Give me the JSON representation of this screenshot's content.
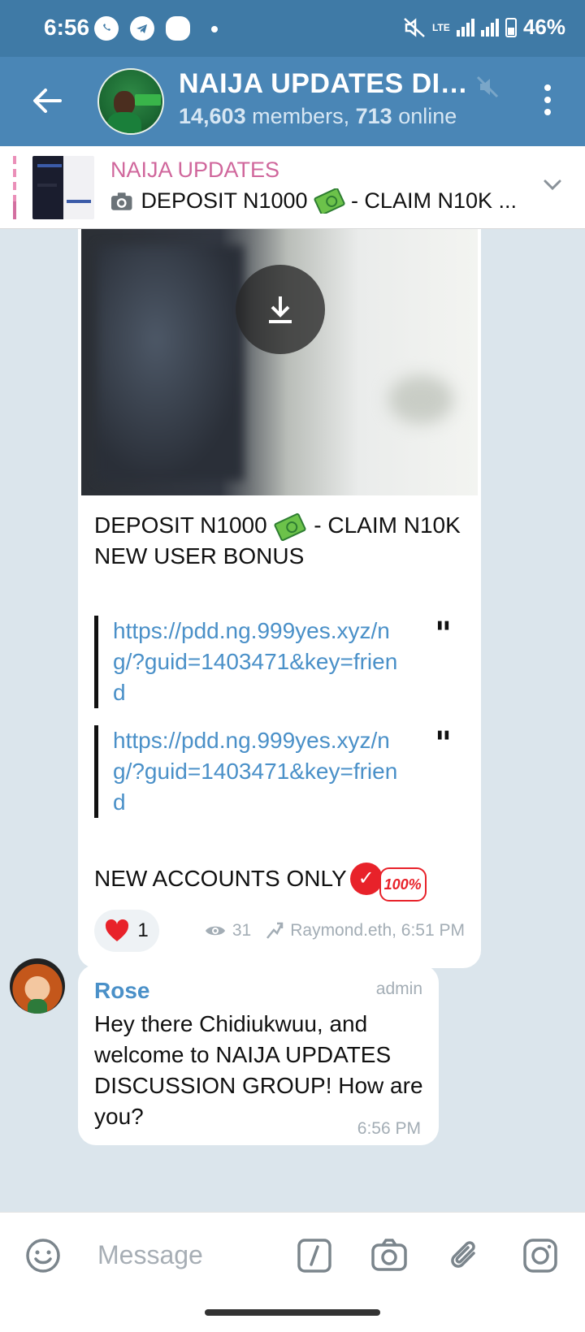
{
  "status_bar": {
    "time": "6:56",
    "network": "LTE",
    "battery": "46%"
  },
  "header": {
    "title": "NAIJA UPDATES DIS...",
    "members": "14,603",
    "members_suffix": " members, ",
    "online": "713",
    "online_suffix": " online"
  },
  "pinned": {
    "title": "NAIJA UPDATES",
    "text_before": "DEPOSIT N1000",
    "text_after": "- CLAIM N10K ..."
  },
  "post": {
    "line1_before": "DEPOSIT N1000",
    "line1_after": " - CLAIM N10K",
    "line2": "NEW USER BONUS",
    "links": [
      "https://pdd.ng.999yes.xyz/ng/?guid=1403471&key=friend",
      "https://pdd.ng.999yes.xyz/ng/?guid=1403471&key=friend"
    ],
    "footer_text": "NEW ACCOUNTS ONLY",
    "badge_text": "100%",
    "reaction_count": "1",
    "views": "31",
    "author_time": "Raymond.eth, 6:51 PM"
  },
  "reply": {
    "name": "Rose",
    "role": "admin",
    "text": "Hey there Chidiukwuu, and welcome to NAIJA UPDATES DISCUSSION GROUP! How are you?",
    "time": "6:56 PM"
  },
  "composer": {
    "placeholder": "Message"
  },
  "colors": {
    "header": "#4a86b6",
    "status": "#3f7aa6",
    "link": "#4a90c8",
    "pinned_title": "#d0679c"
  }
}
